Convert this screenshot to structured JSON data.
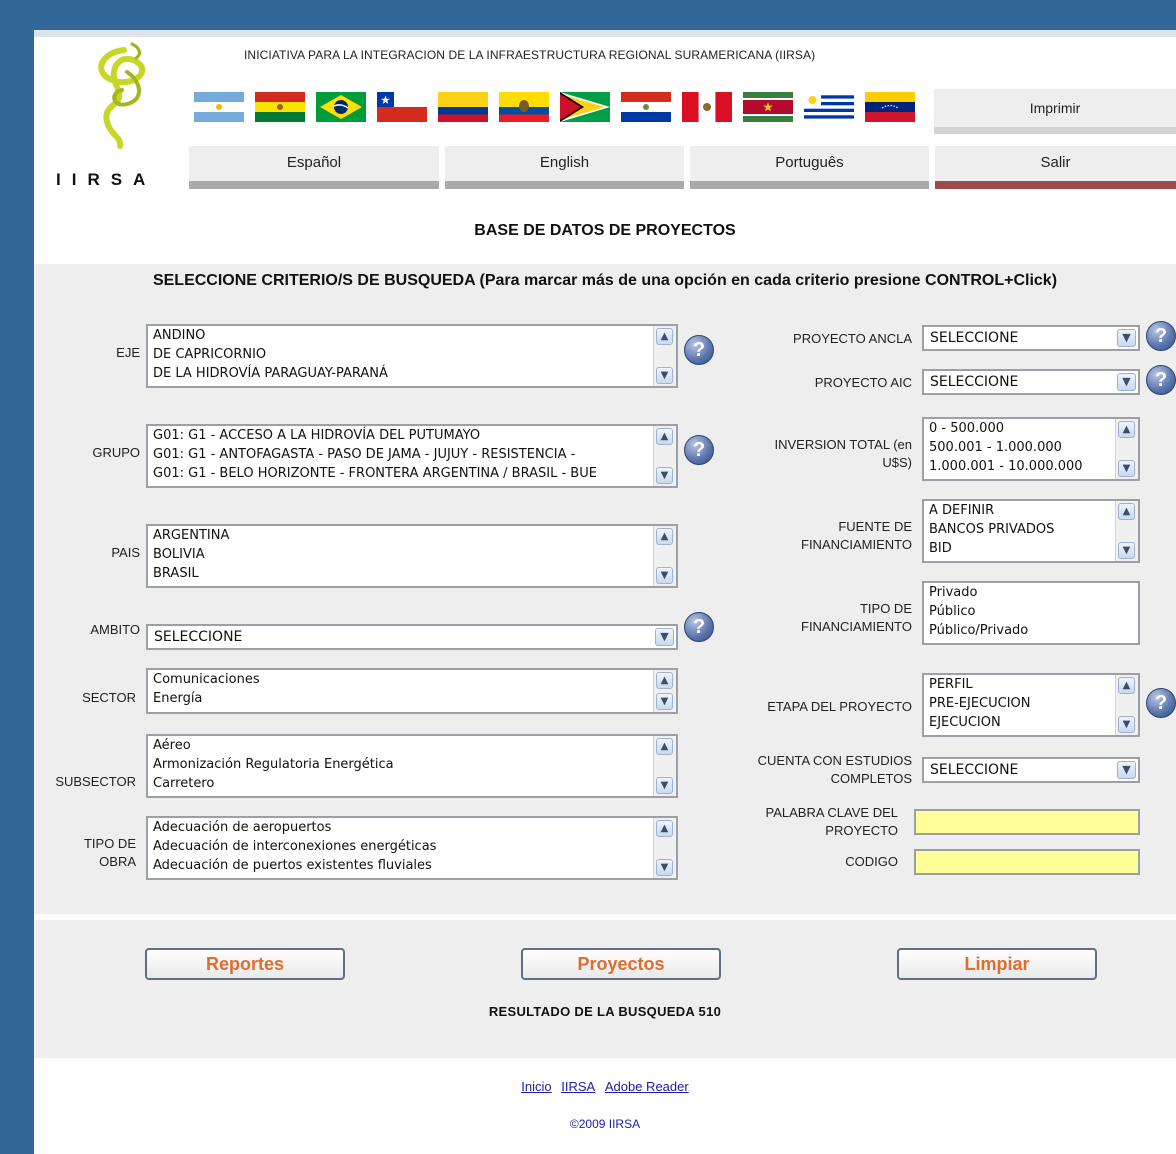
{
  "header": {
    "site_title": "INICIATIVA PARA LA INTEGRACION DE LA INFRAESTRUCTURA REGIONAL SURAMERICANA (IIRSA)",
    "logo_text": "IIRSA",
    "print_label": "Imprimir",
    "flags": [
      "argentina-flag",
      "bolivia-flag",
      "brazil-flag",
      "chile-flag",
      "colombia-flag",
      "ecuador-flag",
      "guyana-flag",
      "paraguay-flag",
      "peru-flag",
      "suriname-flag",
      "uruguay-flag",
      "venezuela-flag"
    ],
    "nav": {
      "es": "Español",
      "en": "English",
      "pt": "Português",
      "exit": "Salir"
    }
  },
  "page_title": "BASE DE DATOS DE PROYECTOS",
  "instructions": "SELECCIONE CRITERIO/S DE BUSQUEDA (Para marcar más de una opción en cada criterio presione CONTROL+Click)",
  "fields": {
    "eje": {
      "label": "EJE",
      "options": [
        "ANDINO",
        "DE CAPRICORNIO",
        "DE LA HIDROVÍA PARAGUAY-PARANÁ"
      ]
    },
    "grupo": {
      "label": "GRUPO",
      "options": [
        "G01: G1 - ACCESO A LA HIDROVÍA DEL PUTUMAYO",
        "G01: G1 - ANTOFAGASTA - PASO DE JAMA - JUJUY - RESISTENCIA -",
        "G01: G1 - BELO HORIZONTE - FRONTERA ARGENTINA / BRASIL - BUE"
      ]
    },
    "pais": {
      "label": "PAIS",
      "options": [
        "ARGENTINA",
        "BOLIVIA",
        "BRASIL"
      ]
    },
    "ambito": {
      "label": "AMBITO",
      "value": "SELECCIONE"
    },
    "sector": {
      "label": "SECTOR",
      "options": [
        "Comunicaciones",
        "Energía"
      ]
    },
    "subsector": {
      "label": "SUBSECTOR",
      "options": [
        "Aéreo",
        "Armonización Regulatoria Energética",
        "Carretero"
      ]
    },
    "tipo_obra": {
      "label_1": "TIPO DE",
      "label_2": "OBRA",
      "options": [
        "Adecuación de aeropuertos",
        "Adecuación de interconexiones energéticas",
        "Adecuación de puertos existentes fluviales"
      ]
    },
    "proyecto_ancla": {
      "label": "PROYECTO ANCLA",
      "value": "SELECCIONE"
    },
    "proyecto_aic": {
      "label": "PROYECTO AIC",
      "value": "SELECCIONE"
    },
    "inversion_total": {
      "label_1": "INVERSION TOTAL (en",
      "label_2": "U$S)",
      "options": [
        "0 - 500.000",
        "500.001 - 1.000.000",
        "1.000.001 - 10.000.000"
      ]
    },
    "fuente_financiamiento": {
      "label_1": "FUENTE DE",
      "label_2": "FINANCIAMIENTO",
      "options": [
        "A DEFINIR",
        "BANCOS PRIVADOS",
        "BID"
      ]
    },
    "tipo_financiamiento": {
      "label_1": "TIPO DE",
      "label_2": "FINANCIAMIENTO",
      "options": [
        "Privado",
        "Público",
        "Público/Privado"
      ]
    },
    "etapa_proyecto": {
      "label": "ETAPA DEL PROYECTO",
      "options": [
        "PERFIL",
        "PRE-EJECUCION",
        "EJECUCION"
      ]
    },
    "estudios_completos": {
      "label_1": "CUENTA CON ESTUDIOS",
      "label_2": "COMPLETOS",
      "value": "SELECCIONE"
    },
    "palabra_clave": {
      "label_1": "PALABRA CLAVE DEL",
      "label_2": "PROYECTO",
      "value": ""
    },
    "codigo": {
      "label": "CODIGO",
      "value": ""
    }
  },
  "buttons": {
    "reportes": "Reportes",
    "proyectos": "Proyectos",
    "limpiar": "Limpiar"
  },
  "result_text": "RESULTADO DE LA BUSQUEDA 510",
  "footer": {
    "links": [
      "Inicio",
      "IIRSA",
      "Adobe Reader"
    ],
    "copyright": "©2009 IIRSA"
  },
  "colors": {
    "frame": "#336699",
    "panel": "#eeeeee",
    "button_text": "#e06c2e",
    "text_input": "#ffff99",
    "link": "#1d1da8"
  }
}
